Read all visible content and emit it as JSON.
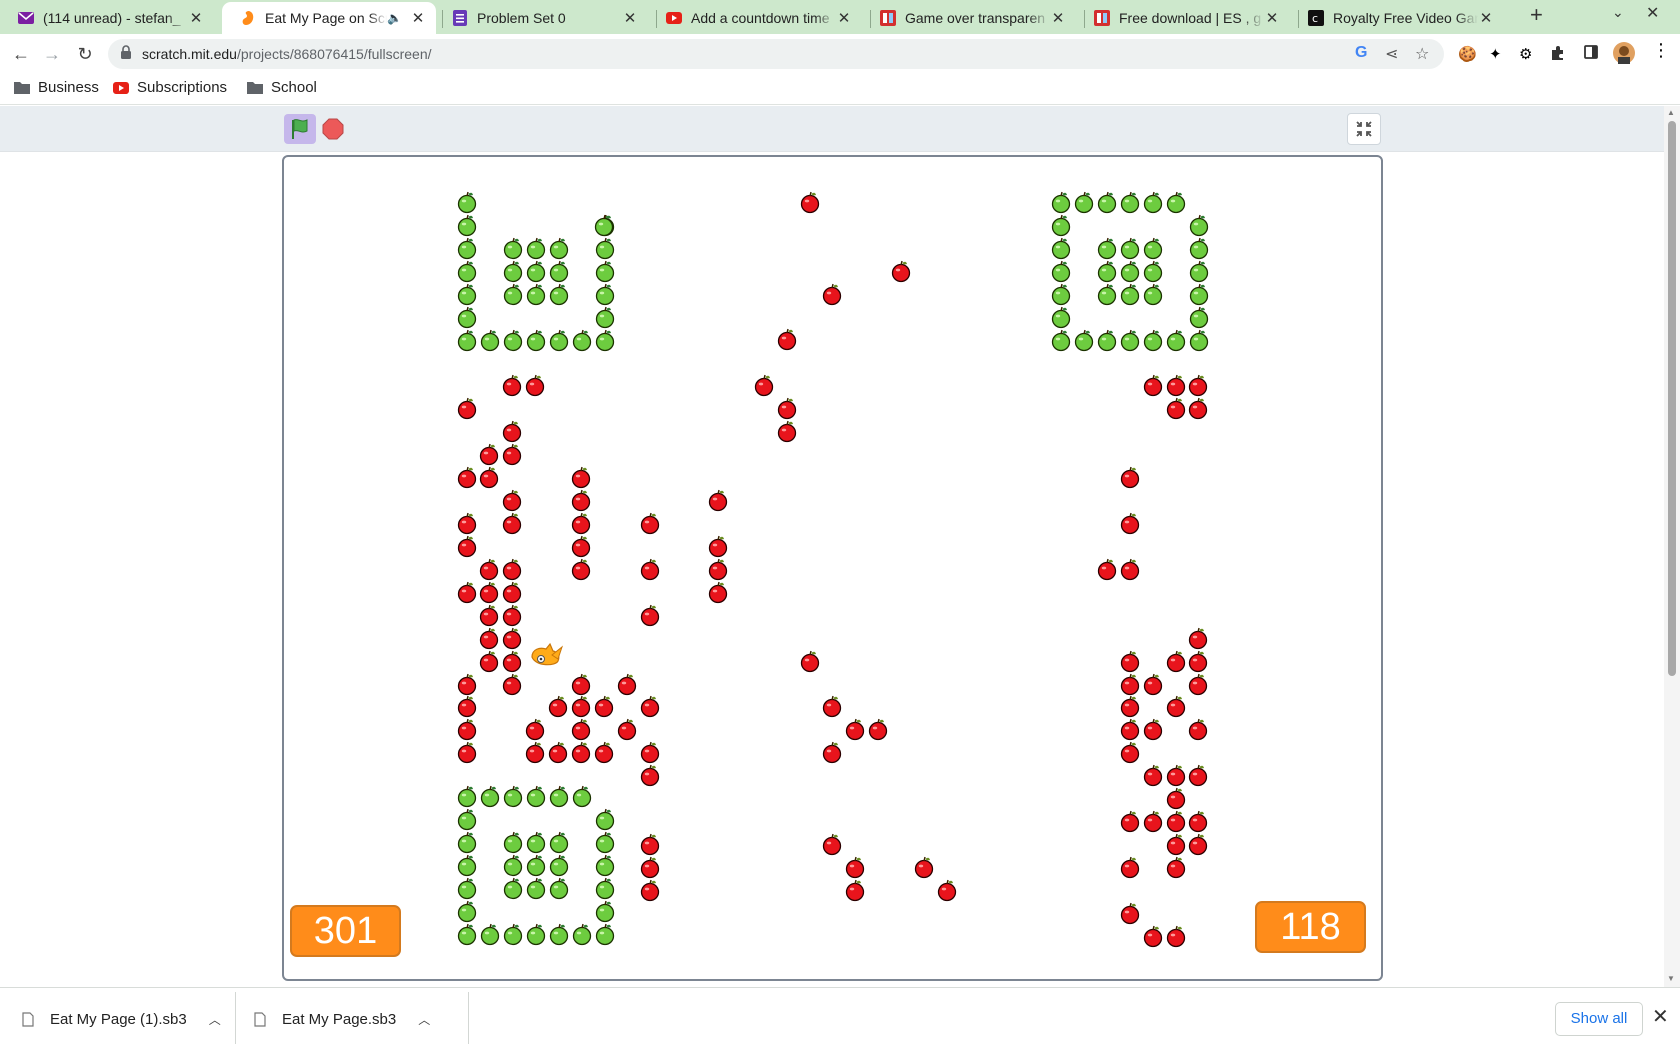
{
  "browser": {
    "tabs": [
      {
        "title": "(114 unread) - stefan_",
        "icon": "mail-icon",
        "color": "#7b1fa2",
        "active": false
      },
      {
        "title": "Eat My Page on Scr",
        "icon": "scratch-icon",
        "color": "#ff8c1a",
        "active": true,
        "audio": "speaker-icon"
      },
      {
        "title": "Problem Set 0",
        "icon": "forms-icon",
        "color": "#673ab7",
        "active": false
      },
      {
        "title": "Add a countdown time",
        "icon": "youtube-icon",
        "color": "#e62117",
        "active": false
      },
      {
        "title": "Game over transparen",
        "icon": "image-site-icon",
        "color": "#d32f2f",
        "active": false
      },
      {
        "title": "Free download | ES , g",
        "icon": "image-site-icon",
        "color": "#d32f2f",
        "active": false
      },
      {
        "title": "Royalty Free Video Gar",
        "icon": "audio-site-icon",
        "color": "#111111",
        "active": false
      }
    ],
    "url_domain": "scratch.mit.edu",
    "url_path": "/projects/868076415/fullscreen/",
    "bookmarks": [
      {
        "label": "Business",
        "icon": "folder-icon"
      },
      {
        "label": "Subscriptions",
        "icon": "youtube-icon"
      },
      {
        "label": "School",
        "icon": "folder-icon"
      }
    ]
  },
  "scratch": {
    "controls": {
      "green_flag": "green-flag-icon",
      "stop": "stop-icon",
      "fullscreen": "exit-fullscreen-icon"
    },
    "score_left": "301",
    "score_right": "118",
    "colors": {
      "green_apple": "#6dcc3f",
      "red_apple": "#e8141c",
      "score_bg": "#ff8c1a"
    }
  },
  "downloads": {
    "items": [
      {
        "name": "Eat My Page (1).sb3",
        "icon": "file-icon"
      },
      {
        "name": "Eat My Page.sb3",
        "icon": "file-icon"
      }
    ],
    "show_all_label": "Show all"
  }
}
